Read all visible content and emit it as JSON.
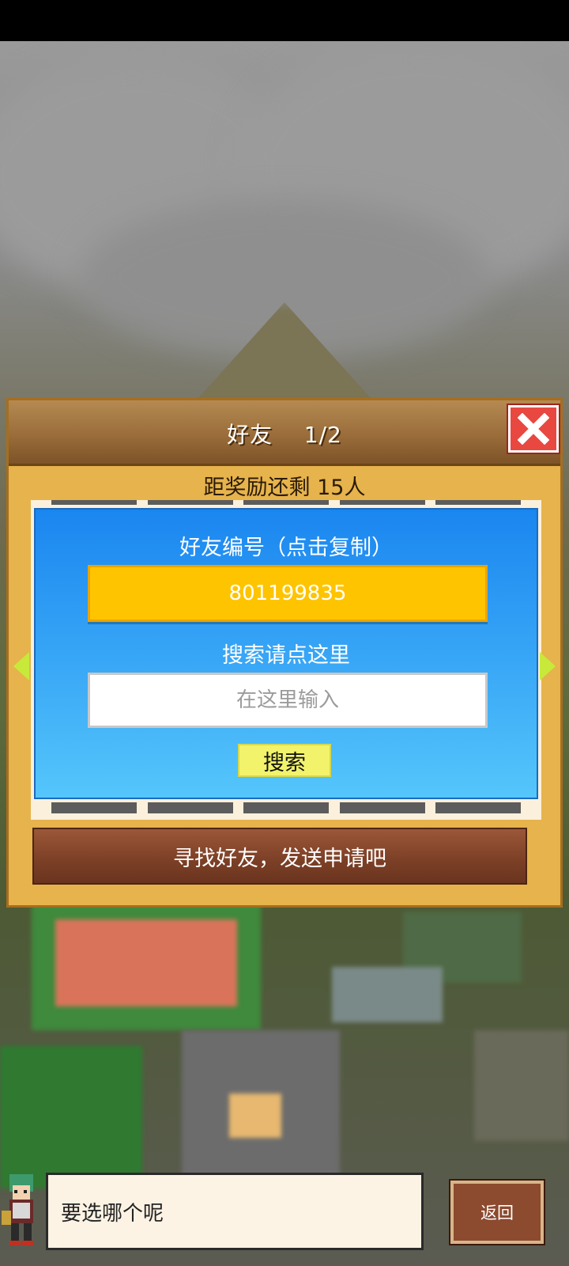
{
  "dialog": {
    "title": "好友",
    "page_indicator": "1/2",
    "reward_text": "距奖励还剩 15人",
    "friend_id_label": "好友编号（点击复制）",
    "friend_id_value": "801199835",
    "search_label": "搜索请点这里",
    "search_placeholder": "在这里输入",
    "search_button": "搜索",
    "send_banner": "寻找好友，发送申请吧"
  },
  "footer": {
    "speech_text": "要选哪个呢",
    "back_button": "返回"
  },
  "icons": {
    "close": "close-icon",
    "prev": "arrow-left-icon",
    "next": "arrow-right-icon"
  },
  "colors": {
    "accent_yellow": "#fec400",
    "close_red": "#e84840",
    "panel_blue": "#1a86f0"
  }
}
